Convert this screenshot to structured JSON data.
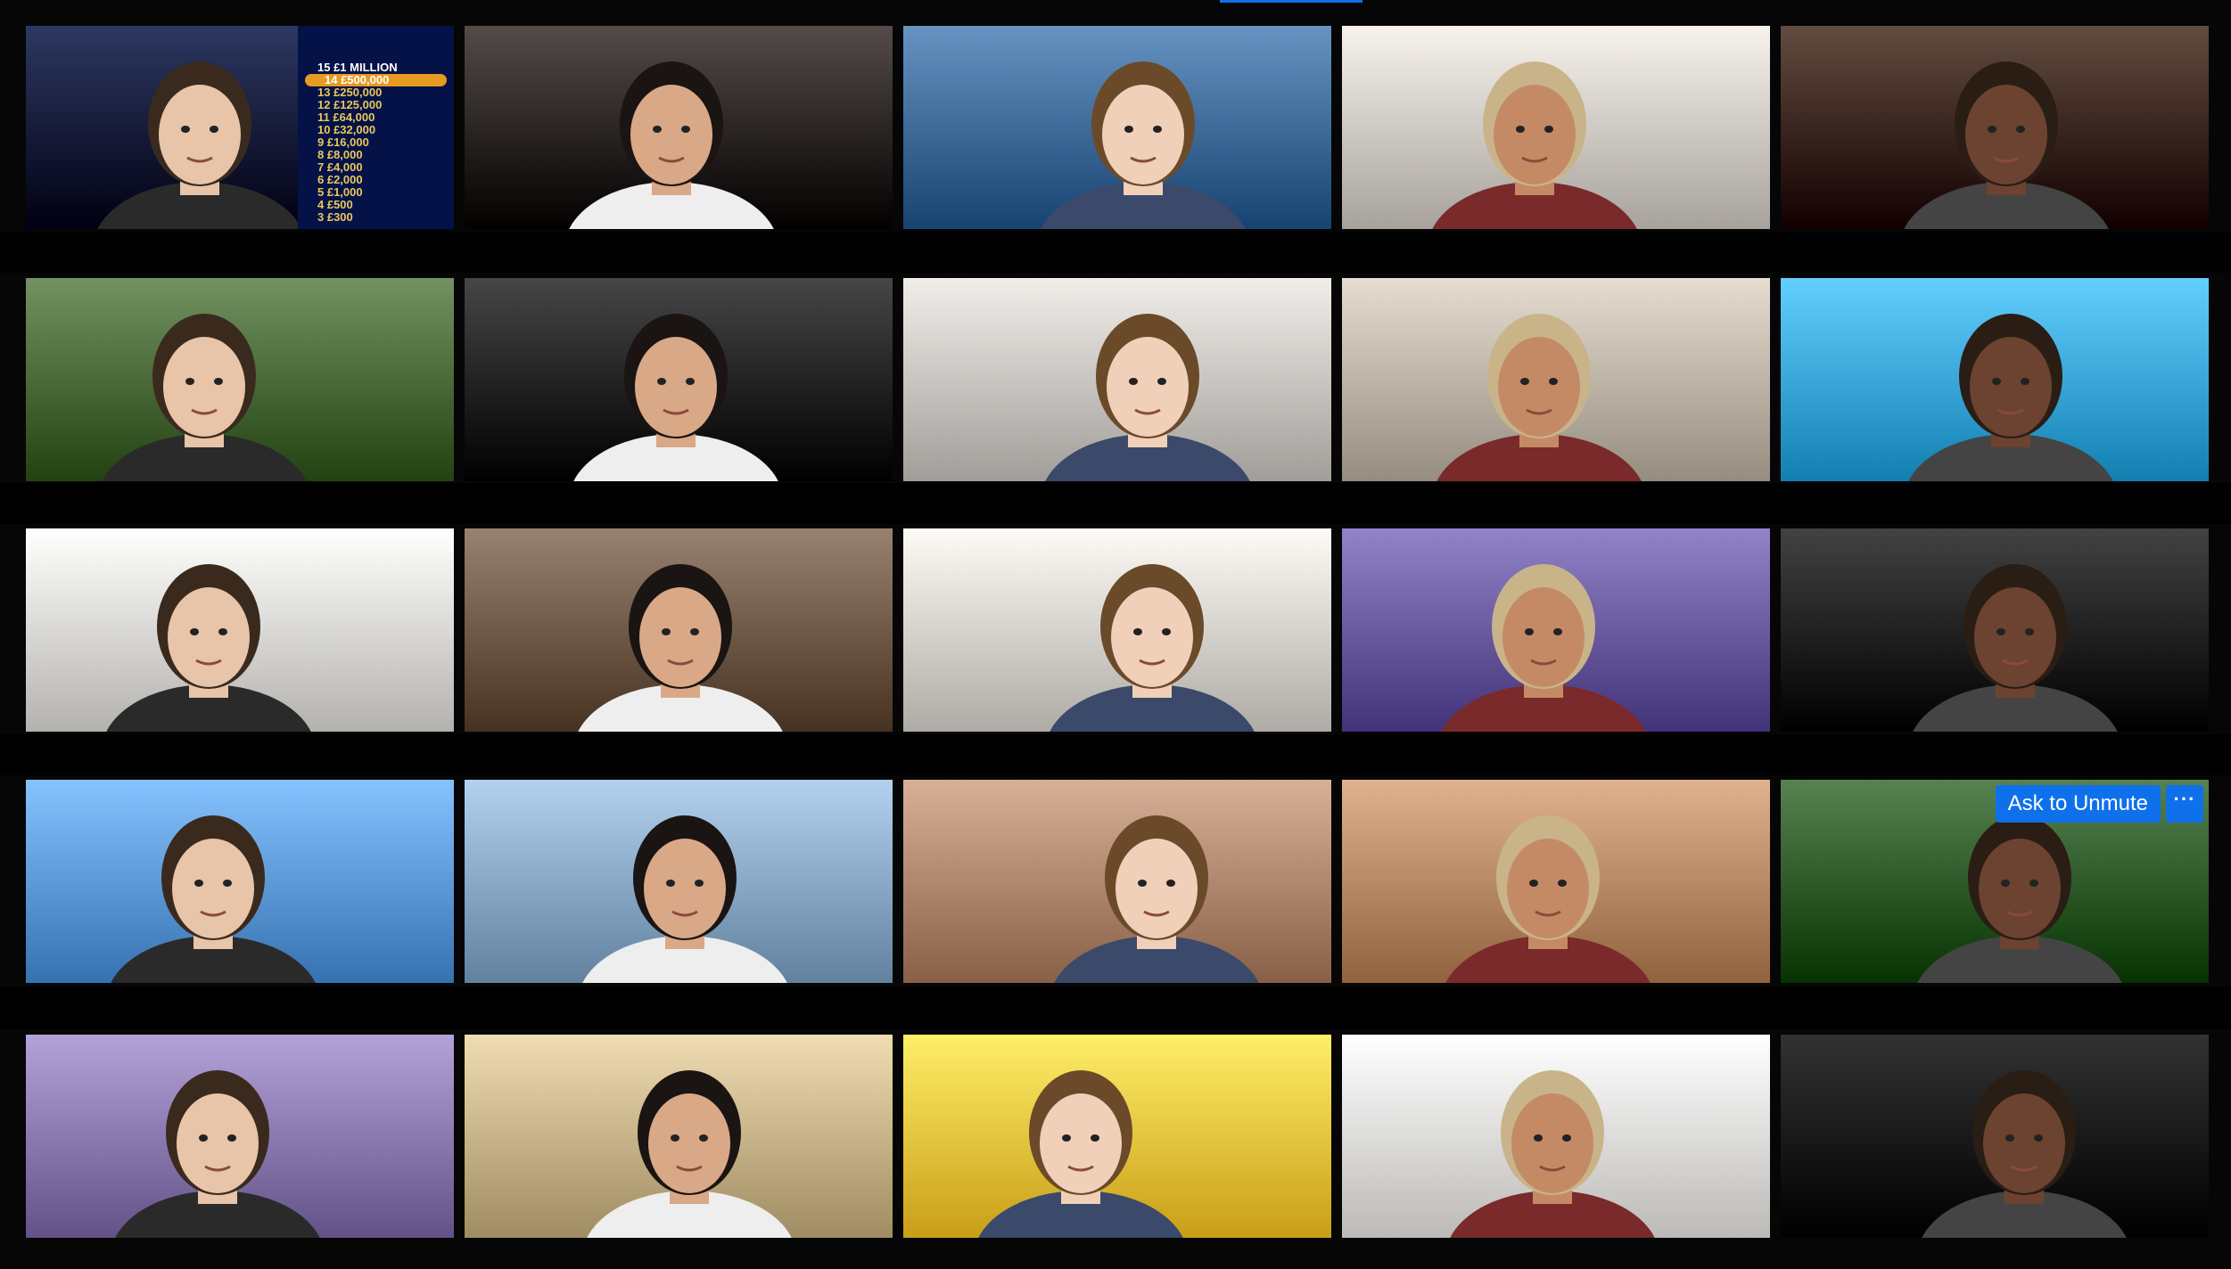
{
  "window": {
    "view": "Gallery View"
  },
  "colors": {
    "accent": "#0e71eb",
    "background": "#060606"
  },
  "overlay": {
    "ask_to_unmute_label": "Ask to Unmute",
    "more_label": "···"
  },
  "millionaire_board": {
    "rows": [
      "15  £1 MILLION",
      "14  £500,000",
      "13  £250,000",
      "12  £125,000",
      "11  £64,000",
      "10  £32,000",
      "9  £16,000",
      "8  £8,000",
      "7  £4,000",
      "6  £2,000",
      "5  £1,000",
      "4  £500",
      "3  £300"
    ],
    "highlight_index": 1
  },
  "tiles": [
    {
      "id": 1,
      "scene": "millionaire-board",
      "bg": "#05103a"
    },
    {
      "id": 2,
      "scene": "bar-interior",
      "bg": "#2b2320"
    },
    {
      "id": 3,
      "scene": "bedroom-blue-curtains",
      "bg": "#3f6b9a"
    },
    {
      "id": 4,
      "scene": "white-room-clock",
      "bg": "#cfcac4"
    },
    {
      "id": 5,
      "scene": "dark-pub",
      "bg": "#3a2418"
    },
    {
      "id": 6,
      "scene": "football-stadium",
      "bg": "#4a6a3a"
    },
    {
      "id": 7,
      "scene": "spaceship-cockpit",
      "bg": "#1e1e20"
    },
    {
      "id": 8,
      "scene": "plain-wall",
      "bg": "#c9c6c2"
    },
    {
      "id": 9,
      "scene": "room-with-dancer",
      "bg": "#bdb5a8"
    },
    {
      "id": 10,
      "scene": "pineapple-house",
      "bg": "#3aa7d9"
    },
    {
      "id": 11,
      "scene": "bright-room",
      "bg": "#dcdad6"
    },
    {
      "id": 12,
      "scene": "hotel-corridor",
      "bg": "#6f5a49"
    },
    {
      "id": 13,
      "scene": "white-room",
      "bg": "#d6d3ce"
    },
    {
      "id": 14,
      "scene": "city-skyline",
      "bg": "#6a5aa0"
    },
    {
      "id": 15,
      "scene": "moon-surface",
      "bg": "#1a1a1a"
    },
    {
      "id": 16,
      "scene": "green-hills-faces",
      "bg": "#5e9ad8"
    },
    {
      "id": 17,
      "scene": "bookshelf-room",
      "bg": "#8aa9c6"
    },
    {
      "id": 18,
      "scene": "face-collage",
      "bg": "#b08870"
    },
    {
      "id": 19,
      "scene": "cartoon-room",
      "bg": "#b98a66"
    },
    {
      "id": 20,
      "scene": "forest",
      "bg": "#2f5a2a",
      "has_overlay": true
    },
    {
      "id": 21,
      "scene": "ice-rink",
      "bg": "#8a7ab0"
    },
    {
      "id": 22,
      "scene": "office-lobby",
      "bg": "#c8b48a"
    },
    {
      "id": 23,
      "scene": "this-is-fine",
      "bg": "#f1c640"
    },
    {
      "id": 24,
      "scene": "white-room-window",
      "bg": "#e4e2df"
    },
    {
      "id": 25,
      "scene": "dark-band-portrait",
      "bg": "#0a0a0a"
    }
  ]
}
